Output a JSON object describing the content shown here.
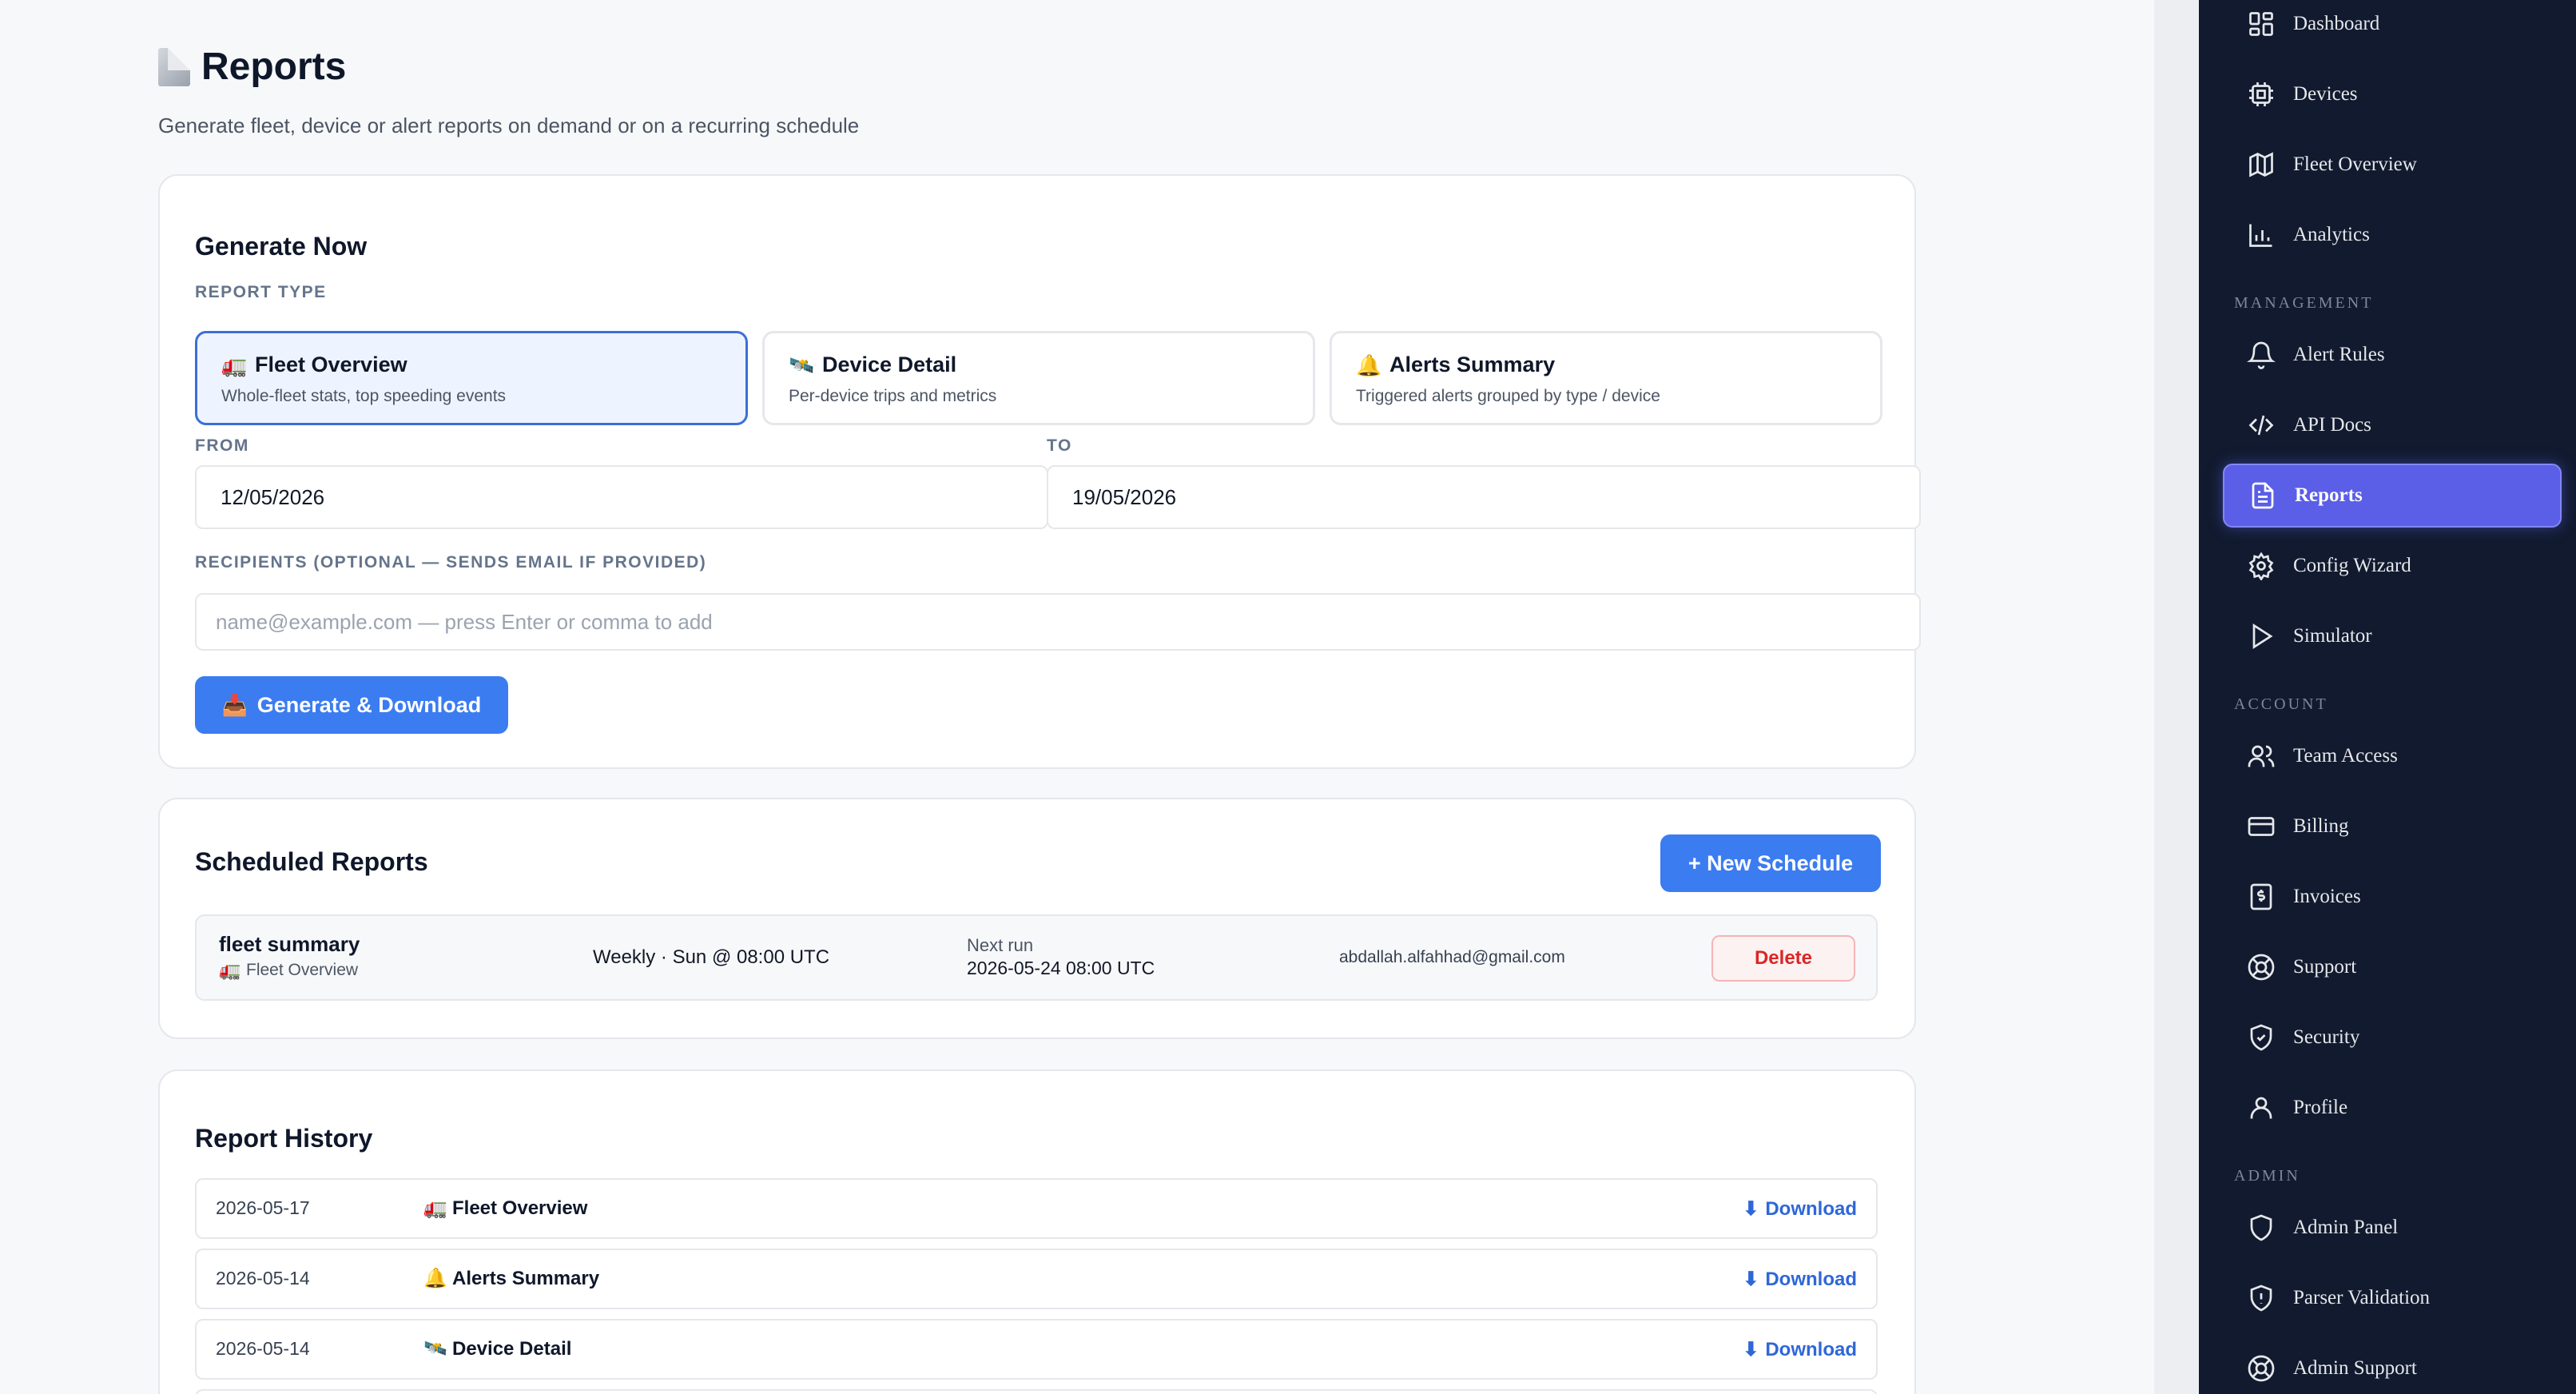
{
  "page": {
    "title": "Reports",
    "subtitle": "Generate fleet, device or alert reports on demand or on a recurring schedule"
  },
  "generate": {
    "title": "Generate Now",
    "report_type_label": "REPORT TYPE",
    "types": [
      {
        "emoji": "🚛",
        "title": "Fleet Overview",
        "desc": "Whole-fleet stats, top speeding events",
        "selected": true
      },
      {
        "emoji": "🛰️",
        "title": "Device Detail",
        "desc": "Per-device trips and metrics",
        "selected": false
      },
      {
        "emoji": "🔔",
        "title": "Alerts Summary",
        "desc": "Triggered alerts grouped by type / device",
        "selected": false
      }
    ],
    "from_label": "FROM",
    "from_value": "12/05/2026",
    "to_label": "TO",
    "to_value": "19/05/2026",
    "recipients_label": "RECIPIENTS (OPTIONAL — SENDS EMAIL IF PROVIDED)",
    "recipients_placeholder": "name@example.com — press Enter or comma to add",
    "button_emoji": "📥",
    "button_label": "Generate & Download"
  },
  "scheduled": {
    "title": "Scheduled Reports",
    "new_button": "+ New Schedule",
    "rows": [
      {
        "name": "fleet summary",
        "type_emoji": "🚛",
        "type": "Fleet Overview",
        "frequency": "Weekly · Sun @ 08:00 UTC",
        "next_run_label": "Next run",
        "next_run": "2026-05-24 08:00 UTC",
        "email": "abdallah.alfahhad@gmail.com",
        "delete_label": "Delete"
      }
    ]
  },
  "history": {
    "title": "Report History",
    "download_icon": "⬇",
    "rows": [
      {
        "date": "2026-05-17",
        "emoji": "🚛",
        "type": "Fleet Overview",
        "action": "Download"
      },
      {
        "date": "2026-05-14",
        "emoji": "🔔",
        "type": "Alerts Summary",
        "action": "Download"
      },
      {
        "date": "2026-05-14",
        "emoji": "🛰️",
        "type": "Device Detail",
        "action": "Download"
      }
    ]
  },
  "sidebar": {
    "items_top": [
      {
        "icon": "dashboard-icon",
        "label": "Dashboard"
      },
      {
        "icon": "chip-icon",
        "label": "Devices"
      },
      {
        "icon": "map-icon",
        "label": "Fleet Overview"
      },
      {
        "icon": "bar-chart-icon",
        "label": "Analytics"
      }
    ],
    "management_label": "MANAGEMENT",
    "items_management": [
      {
        "icon": "bell-icon",
        "label": "Alert Rules"
      },
      {
        "icon": "code-icon",
        "label": "API Docs"
      },
      {
        "icon": "document-icon",
        "label": "Reports",
        "active": true
      },
      {
        "icon": "gear-icon",
        "label": "Config Wizard"
      },
      {
        "icon": "play-icon",
        "label": "Simulator"
      }
    ],
    "account_label": "ACCOUNT",
    "items_account": [
      {
        "icon": "users-icon",
        "label": "Team Access"
      },
      {
        "icon": "credit-card-icon",
        "label": "Billing"
      },
      {
        "icon": "invoice-icon",
        "label": "Invoices"
      },
      {
        "icon": "lifebuoy-icon",
        "label": "Support"
      },
      {
        "icon": "shield-check-icon",
        "label": "Security"
      },
      {
        "icon": "user-icon",
        "label": "Profile"
      }
    ],
    "admin_label": "ADMIN",
    "items_admin": [
      {
        "icon": "shield-icon",
        "label": "Admin Panel"
      },
      {
        "icon": "shield-alert-icon",
        "label": "Parser Validation"
      },
      {
        "icon": "lifebuoy-icon",
        "label": "Admin Support"
      }
    ]
  }
}
